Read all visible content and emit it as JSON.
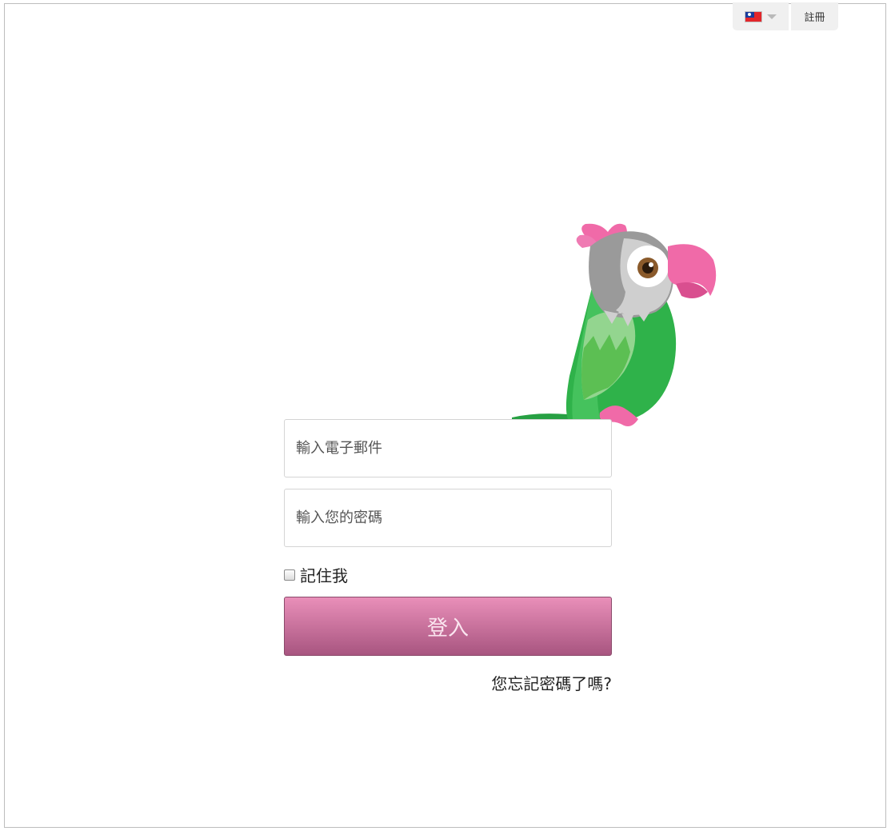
{
  "header": {
    "language_flag": "taiwan-flag-icon",
    "register_label": "註冊"
  },
  "login_form": {
    "email_placeholder": "輸入電子郵件",
    "password_placeholder": "輸入您的密碼",
    "remember_label": "記住我",
    "submit_label": "登入",
    "forgot_label": "您忘記密碼了嗎?"
  },
  "colors": {
    "button_top": "#e98fb9",
    "button_bottom": "#a85580",
    "parrot_green": "#2fb24a",
    "parrot_pink": "#f06aa8",
    "parrot_gray": "#9a9a9a"
  }
}
